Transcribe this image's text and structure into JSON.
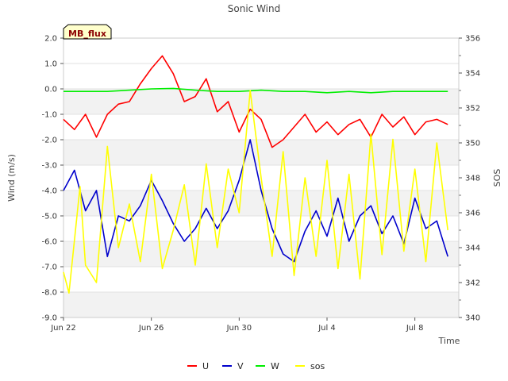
{
  "chart_data": {
    "type": "line",
    "title": "Sonic Wind",
    "badge": "MB_flux",
    "xlabel": "Time",
    "ylabel_left": "Wind (m/s)",
    "ylabel_right": "SOS",
    "x_range": [
      "2022-06-22",
      "2022-07-10"
    ],
    "x_ticks": [
      {
        "date": "2022-06-22",
        "label": "Jun 22"
      },
      {
        "date": "2022-06-26",
        "label": "Jun 26"
      },
      {
        "date": "2022-06-30",
        "label": "Jun 30"
      },
      {
        "date": "2022-07-04",
        "label": "Jul 4"
      },
      {
        "date": "2022-07-08",
        "label": "Jul 8"
      }
    ],
    "y_left": {
      "min": -9.0,
      "max": 2.0,
      "ticks": [
        "2.0",
        "1.0",
        "0.0",
        "-1.0",
        "-2.0",
        "-3.0",
        "-4.0",
        "-5.0",
        "-6.0",
        "-7.0",
        "-8.0",
        "-9.0"
      ]
    },
    "y_right": {
      "min": 340,
      "max": 356,
      "ticks": [
        "356",
        "354",
        "352",
        "350",
        "348",
        "346",
        "344",
        "342",
        "340"
      ]
    },
    "grid": true,
    "legend_position": "bottom",
    "series": [
      {
        "name": "U",
        "color": "#ff0000",
        "axis": "left",
        "points": [
          [
            "2022-06-22",
            -1.2
          ],
          [
            "2022-06-22T12:00",
            -1.6
          ],
          [
            "2022-06-23",
            -1.0
          ],
          [
            "2022-06-23T12:00",
            -1.9
          ],
          [
            "2022-06-24",
            -1.0
          ],
          [
            "2022-06-24T12:00",
            -0.6
          ],
          [
            "2022-06-25",
            -0.5
          ],
          [
            "2022-06-25T12:00",
            0.2
          ],
          [
            "2022-06-26",
            0.8
          ],
          [
            "2022-06-26T12:00",
            1.3
          ],
          [
            "2022-06-27",
            0.6
          ],
          [
            "2022-06-27T12:00",
            -0.5
          ],
          [
            "2022-06-28",
            -0.3
          ],
          [
            "2022-06-28T12:00",
            0.4
          ],
          [
            "2022-06-29",
            -0.9
          ],
          [
            "2022-06-29T12:00",
            -0.5
          ],
          [
            "2022-06-30",
            -1.7
          ],
          [
            "2022-06-30T12:00",
            -0.8
          ],
          [
            "2022-07-01",
            -1.2
          ],
          [
            "2022-07-01T12:00",
            -2.3
          ],
          [
            "2022-07-02",
            -2.0
          ],
          [
            "2022-07-02T12:00",
            -1.5
          ],
          [
            "2022-07-03",
            -1.0
          ],
          [
            "2022-07-03T12:00",
            -1.7
          ],
          [
            "2022-07-04",
            -1.3
          ],
          [
            "2022-07-04T12:00",
            -1.8
          ],
          [
            "2022-07-05",
            -1.4
          ],
          [
            "2022-07-05T12:00",
            -1.2
          ],
          [
            "2022-07-06",
            -1.9
          ],
          [
            "2022-07-06T12:00",
            -1.0
          ],
          [
            "2022-07-07",
            -1.5
          ],
          [
            "2022-07-07T12:00",
            -1.1
          ],
          [
            "2022-07-08",
            -1.8
          ],
          [
            "2022-07-08T12:00",
            -1.3
          ],
          [
            "2022-07-09",
            -1.2
          ],
          [
            "2022-07-09T12:00",
            -1.4
          ]
        ]
      },
      {
        "name": "V",
        "color": "#0000cc",
        "axis": "left",
        "points": [
          [
            "2022-06-22",
            -4.0
          ],
          [
            "2022-06-22T12:00",
            -3.2
          ],
          [
            "2022-06-23",
            -4.8
          ],
          [
            "2022-06-23T12:00",
            -4.0
          ],
          [
            "2022-06-24",
            -6.6
          ],
          [
            "2022-06-24T12:00",
            -5.0
          ],
          [
            "2022-06-25",
            -5.2
          ],
          [
            "2022-06-25T12:00",
            -4.6
          ],
          [
            "2022-06-26",
            -3.6
          ],
          [
            "2022-06-26T12:00",
            -4.4
          ],
          [
            "2022-06-27",
            -5.3
          ],
          [
            "2022-06-27T12:00",
            -6.0
          ],
          [
            "2022-06-28",
            -5.5
          ],
          [
            "2022-06-28T12:00",
            -4.7
          ],
          [
            "2022-06-29",
            -5.5
          ],
          [
            "2022-06-29T12:00",
            -4.8
          ],
          [
            "2022-06-30",
            -3.6
          ],
          [
            "2022-06-30T12:00",
            -2.0
          ],
          [
            "2022-07-01",
            -4.0
          ],
          [
            "2022-07-01T12:00",
            -5.5
          ],
          [
            "2022-07-02",
            -6.5
          ],
          [
            "2022-07-02T12:00",
            -6.8
          ],
          [
            "2022-07-03",
            -5.6
          ],
          [
            "2022-07-03T12:00",
            -4.8
          ],
          [
            "2022-07-04",
            -5.8
          ],
          [
            "2022-07-04T12:00",
            -4.3
          ],
          [
            "2022-07-05",
            -6.0
          ],
          [
            "2022-07-05T12:00",
            -5.0
          ],
          [
            "2022-07-06",
            -4.6
          ],
          [
            "2022-07-06T12:00",
            -5.7
          ],
          [
            "2022-07-07",
            -5.0
          ],
          [
            "2022-07-07T12:00",
            -6.1
          ],
          [
            "2022-07-08",
            -4.3
          ],
          [
            "2022-07-08T12:00",
            -5.5
          ],
          [
            "2022-07-09",
            -5.2
          ],
          [
            "2022-07-09T12:00",
            -6.6
          ]
        ]
      },
      {
        "name": "W",
        "color": "#00ee00",
        "axis": "left",
        "points": [
          [
            "2022-06-22",
            -0.1
          ],
          [
            "2022-06-23",
            -0.1
          ],
          [
            "2022-06-24",
            -0.1
          ],
          [
            "2022-06-25",
            -0.05
          ],
          [
            "2022-06-26",
            0.0
          ],
          [
            "2022-06-27",
            0.02
          ],
          [
            "2022-06-28",
            -0.05
          ],
          [
            "2022-06-29",
            -0.1
          ],
          [
            "2022-06-30",
            -0.1
          ],
          [
            "2022-07-01",
            -0.05
          ],
          [
            "2022-07-02",
            -0.1
          ],
          [
            "2022-07-03",
            -0.1
          ],
          [
            "2022-07-04",
            -0.15
          ],
          [
            "2022-07-05",
            -0.1
          ],
          [
            "2022-07-06",
            -0.15
          ],
          [
            "2022-07-07",
            -0.1
          ],
          [
            "2022-07-08",
            -0.1
          ],
          [
            "2022-07-09",
            -0.1
          ],
          [
            "2022-07-09T12:00",
            -0.1
          ]
        ]
      },
      {
        "name": "sos",
        "color": "#ffff00",
        "axis": "right",
        "points": [
          [
            "2022-06-22",
            342.6
          ],
          [
            "2022-06-22T06:00",
            341.4
          ],
          [
            "2022-06-22T18:00",
            347.5
          ],
          [
            "2022-06-23",
            343.0
          ],
          [
            "2022-06-23T12:00",
            342.0
          ],
          [
            "2022-06-24",
            349.8
          ],
          [
            "2022-06-24T12:00",
            344.0
          ],
          [
            "2022-06-25",
            346.5
          ],
          [
            "2022-06-25T12:00",
            343.2
          ],
          [
            "2022-06-26",
            348.2
          ],
          [
            "2022-06-26T12:00",
            342.8
          ],
          [
            "2022-06-27",
            345.0
          ],
          [
            "2022-06-27T12:00",
            347.6
          ],
          [
            "2022-06-28",
            343.0
          ],
          [
            "2022-06-28T12:00",
            348.8
          ],
          [
            "2022-06-29",
            344.0
          ],
          [
            "2022-06-29T12:00",
            348.5
          ],
          [
            "2022-06-30",
            346.0
          ],
          [
            "2022-06-30T12:00",
            353.0
          ],
          [
            "2022-07-01",
            348.0
          ],
          [
            "2022-07-01T12:00",
            343.5
          ],
          [
            "2022-07-02",
            349.5
          ],
          [
            "2022-07-02T12:00",
            342.4
          ],
          [
            "2022-07-03",
            348.0
          ],
          [
            "2022-07-03T12:00",
            343.5
          ],
          [
            "2022-07-04",
            349.0
          ],
          [
            "2022-07-04T12:00",
            342.8
          ],
          [
            "2022-07-05",
            348.2
          ],
          [
            "2022-07-05T12:00",
            342.2
          ],
          [
            "2022-07-06",
            350.5
          ],
          [
            "2022-07-06T12:00",
            343.6
          ],
          [
            "2022-07-07",
            350.2
          ],
          [
            "2022-07-07T12:00",
            343.8
          ],
          [
            "2022-07-08",
            348.5
          ],
          [
            "2022-07-08T12:00",
            343.2
          ],
          [
            "2022-07-09",
            350.0
          ],
          [
            "2022-07-09T12:00",
            345.0
          ]
        ]
      }
    ]
  }
}
